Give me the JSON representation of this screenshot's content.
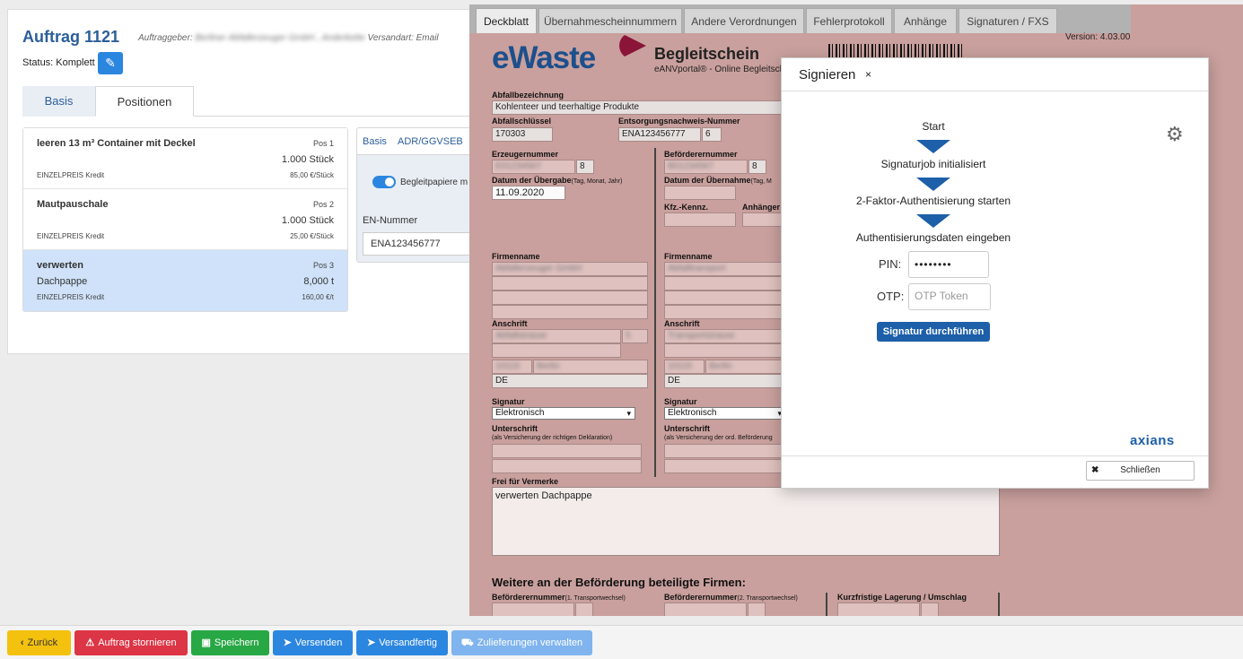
{
  "order": {
    "title": "Auftrag 1121",
    "meta_prefix": "Auftraggeber:",
    "meta_client": "Berliner Abfallerzeuger GmbH , Anderkette",
    "meta_suffix": "Versandart: Email",
    "status": "Status: Komplett",
    "tabs": [
      "Basis",
      "Positionen"
    ],
    "positions": [
      {
        "name": "leeren 13 m³ Container mit Deckel",
        "pos": "Pos 1",
        "qty": "1.000 Stück",
        "sub": "",
        "price_label": "EINZELPREIS Kredit",
        "price": "85,00 €/Stück"
      },
      {
        "name": "Mautpauschale",
        "pos": "Pos 2",
        "qty": "1.000 Stück",
        "sub": "",
        "price_label": "EINZELPREIS Kredit",
        "price": "25,00 €/Stück"
      },
      {
        "name": "verwerten",
        "pos": "Pos 3",
        "qty": "8,000 t",
        "sub": "Dachpappe",
        "price_label": "EINZELPREIS Kredit",
        "price": "160,00 €/t"
      }
    ],
    "detail": {
      "tabs": [
        "Basis",
        "ADR/GGVSEB"
      ],
      "toggle_label": "Begleitpapiere m",
      "en_label": "EN-Nummer",
      "en_value": "ENA123456777"
    }
  },
  "form": {
    "tabs": [
      "Deckblatt",
      "Übernahmescheinnummern",
      "Andere Verordnungen",
      "Fehlerprotokoll",
      "Anhänge",
      "Signaturen / FXS"
    ],
    "active_tab": "Deckblatt",
    "logo": "eWaste",
    "title": "Begleitschein",
    "subtitle": "eANVportal® - Online Begleitsch",
    "version": "Version: 4.03.00",
    "abfallbezeichnung_label": "Abfallbezeichnung",
    "abfallbezeichnung": "Kohlenteer und teerhaltige Produkte",
    "abfallschluessel_label": "Abfallschlüssel",
    "abfallschluessel": "170303",
    "entsorgungsnachweis_label": "Entsorgungsnachweis-Nummer",
    "entsorgungsnachweis": "ENA123456777",
    "entsorgungsnachweis_check": "6",
    "erzeugernummer_label": "Erzeugernummer",
    "erzeugernummer": "E01234567",
    "erzeugernummer_check": "8",
    "befoerderernummer_label": "Beförderernummer",
    "befoerderernummer": "B01234567",
    "befoerderernummer_check": "8",
    "datum_uebergabe_label": "Datum der Übergabe",
    "datum_uebergabe_hint": "(Tag, Monat, Jahr)",
    "datum_uebergabe": "11.09.2020",
    "datum_uebernahme_label": "Datum der Übernahme",
    "datum_uebernahme_hint": "(Tag, M",
    "kfz_label": "Kfz.-Kennz.",
    "anhaenger_label": "Anhänger",
    "firmenname_label": "Firmenname",
    "firmenname_left": "Abfallerzeuger GmbH",
    "firmenname_right": "Abfalltransport",
    "anschrift_label": "Anschrift",
    "strasse_left": "Abfallstrasse",
    "strasse_right": "Transportstrasse",
    "hausnummer_left": "5",
    "plz_left": "10115",
    "ort_left": "Berlin",
    "plz_right": "10115",
    "ort_right": "Berlin",
    "land_left": "DE",
    "land_right": "DE",
    "signatur_label": "Signatur",
    "signatur_value": "Elektronisch",
    "unterschrift_label": "Unterschrift",
    "unterschrift_hint_left": "(als Versicherung der richtigen Deklaration)",
    "unterschrift_hint_right": "(als Versicherung der ord. Beförderung",
    "vermerke_label": "Frei für Vermerke",
    "vermerke": "verwerten Dachpappe",
    "section_title": "Weitere an der Beförderung beteiligte Firmen:",
    "bottom_labels": [
      "Beförderernummer",
      "Beförderernummer",
      "Kurzfristige Lagerung / Umschlag"
    ],
    "bottom_hints": [
      "(1. Transportwechsel)",
      "(2. Transportwechsel)",
      ""
    ]
  },
  "modal": {
    "title": "Signieren",
    "close_x": "×",
    "steps": [
      "Start",
      "Signaturjob initialisiert",
      "2-Faktor-Authentisierung starten",
      "Authentisierungsdaten eingeben"
    ],
    "pin_label": "PIN:",
    "pin_value": "••••••••",
    "otp_label": "OTP:",
    "otp_placeholder": "OTP Token",
    "sign_button": "Signatur durchführen",
    "brand": "axians",
    "close_button": "Schließen"
  },
  "actions": [
    {
      "label": "Zurück",
      "icon": "chevron-left-icon"
    },
    {
      "label": "Auftrag stornieren",
      "icon": "warning-icon"
    },
    {
      "label": "Speichern",
      "icon": "save-icon"
    },
    {
      "label": "Versenden",
      "icon": "send-icon"
    },
    {
      "label": "Versandfertig",
      "icon": "send-icon"
    },
    {
      "label": "Zulieferungen verwalten",
      "icon": "truck-icon"
    }
  ],
  "colors": {
    "primary": "#2b86e0",
    "brand_blue": "#1d5fa8",
    "form_background": "#c9a09d",
    "danger": "#dc3545",
    "success": "#28a745",
    "warning": "#f3c10e"
  }
}
